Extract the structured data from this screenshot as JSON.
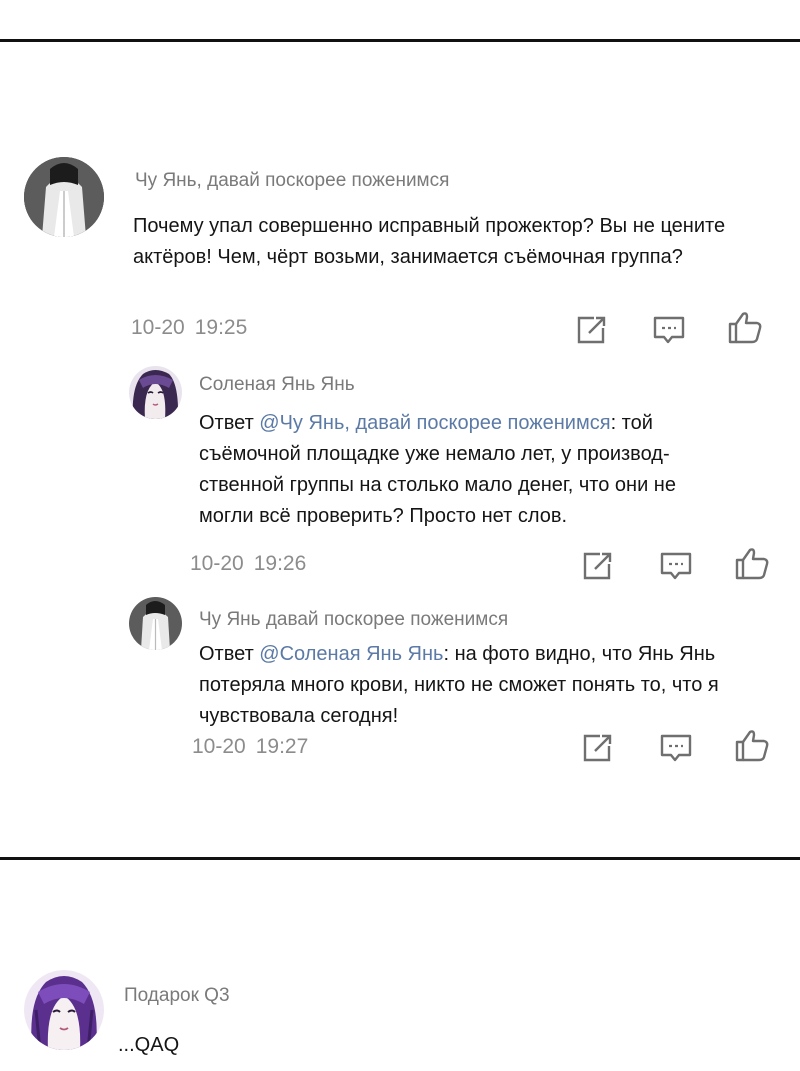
{
  "comments": [
    {
      "username": "Чу Янь, давай поскорее поженимся",
      "text": "Почему упал совершенно исправный прожектор? Вы не цените актёров! Чем, чёрт возьми, занимается съёмочная группа?",
      "date": "10-20",
      "time": "19:25",
      "avatar_icon": "avatar-white-shirt",
      "replies": [
        {
          "username": "Соленая Янь Янь",
          "reply_prefix": "Ответ ",
          "mention": "@Чу Янь, давай поскорее поженимся",
          "text": ": той съёмочной площадке уже немало лет, у производ­ственной группы на столько мало денег, что они не могли всё проверить? Просто нет слов.",
          "date": "10-20",
          "time": "19:26",
          "avatar_icon": "avatar-purple-hair"
        },
        {
          "username": "Чу Янь давай поскорее поженимся",
          "reply_prefix": "Ответ ",
          "mention": "@Соленая Янь Янь",
          "text": ": на фото видно, что Янь Янь потеряла много крови, никто не сможет понять то, что я чувствовала сегодня!",
          "date": "10-20",
          "time": "19:27",
          "avatar_icon": "avatar-white-shirt"
        }
      ]
    },
    {
      "username": "Подарок Q3",
      "text": "...QAQ",
      "avatar_icon": "avatar-purple-long-hair"
    }
  ],
  "actions": {
    "share_icon": "share-icon",
    "comment_icon": "comment-icon",
    "like_icon": "like-icon"
  },
  "colors": {
    "mention": "#5b7aa6",
    "username": "#7a7a7a",
    "timestamp": "#8c8c8c",
    "icon": "#6f6f6f"
  }
}
